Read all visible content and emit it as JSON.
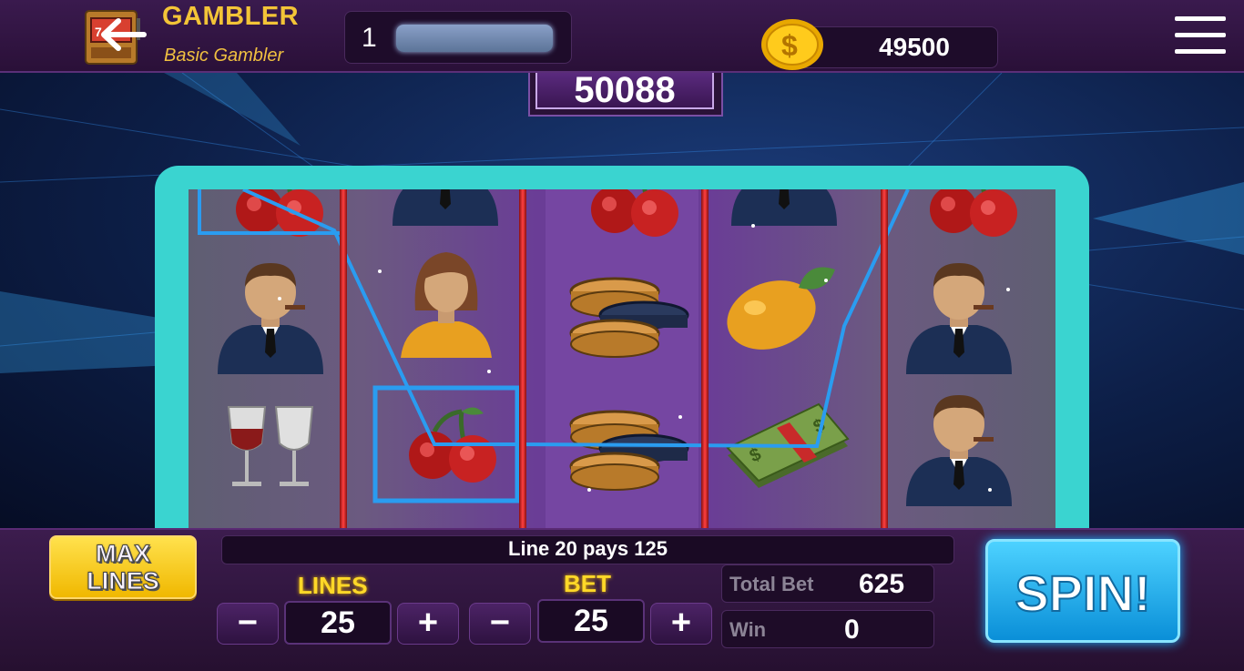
{
  "header": {
    "title": "GAMBLER",
    "rank": "Basic Gambler",
    "level": "1",
    "coins": "49500"
  },
  "jackpot": "50088",
  "reels": [
    [
      "cherries",
      "businessman",
      "wine-glasses"
    ],
    [
      "businessman",
      "woman",
      "cherries"
    ],
    [
      "cherries",
      "coins",
      "coins"
    ],
    [
      "businessman",
      "lemon",
      "cash"
    ],
    [
      "cherries",
      "businessman",
      "businessman"
    ]
  ],
  "controls": {
    "max_lines_1": "MAX",
    "max_lines_2": "LINES",
    "payline_msg": "Line 20 pays 125",
    "lines_label": "LINES",
    "lines_value": "25",
    "bet_label": "BET",
    "bet_value": "25",
    "minus": "−",
    "plus": "+",
    "total_bet_label": "Total Bet",
    "total_bet_value": "625",
    "win_label": "Win",
    "win_value": "0",
    "spin_label": "SPIN!"
  },
  "colors": {
    "accent_gold": "#f3c437",
    "frame_teal": "#3ad4d0",
    "spin_blue": "#1ab0ff",
    "payline_blue": "#2a9cf0"
  }
}
